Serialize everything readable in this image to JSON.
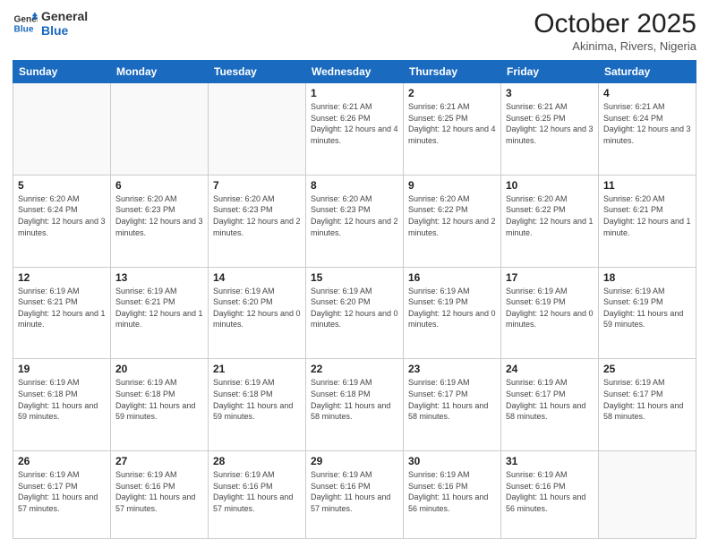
{
  "logo": {
    "line1": "General",
    "line2": "Blue"
  },
  "title": "October 2025",
  "location": "Akinima, Rivers, Nigeria",
  "weekdays": [
    "Sunday",
    "Monday",
    "Tuesday",
    "Wednesday",
    "Thursday",
    "Friday",
    "Saturday"
  ],
  "weeks": [
    [
      {
        "day": "",
        "info": ""
      },
      {
        "day": "",
        "info": ""
      },
      {
        "day": "",
        "info": ""
      },
      {
        "day": "1",
        "info": "Sunrise: 6:21 AM\nSunset: 6:26 PM\nDaylight: 12 hours and 4 minutes."
      },
      {
        "day": "2",
        "info": "Sunrise: 6:21 AM\nSunset: 6:25 PM\nDaylight: 12 hours and 4 minutes."
      },
      {
        "day": "3",
        "info": "Sunrise: 6:21 AM\nSunset: 6:25 PM\nDaylight: 12 hours and 3 minutes."
      },
      {
        "day": "4",
        "info": "Sunrise: 6:21 AM\nSunset: 6:24 PM\nDaylight: 12 hours and 3 minutes."
      }
    ],
    [
      {
        "day": "5",
        "info": "Sunrise: 6:20 AM\nSunset: 6:24 PM\nDaylight: 12 hours and 3 minutes."
      },
      {
        "day": "6",
        "info": "Sunrise: 6:20 AM\nSunset: 6:23 PM\nDaylight: 12 hours and 3 minutes."
      },
      {
        "day": "7",
        "info": "Sunrise: 6:20 AM\nSunset: 6:23 PM\nDaylight: 12 hours and 2 minutes."
      },
      {
        "day": "8",
        "info": "Sunrise: 6:20 AM\nSunset: 6:23 PM\nDaylight: 12 hours and 2 minutes."
      },
      {
        "day": "9",
        "info": "Sunrise: 6:20 AM\nSunset: 6:22 PM\nDaylight: 12 hours and 2 minutes."
      },
      {
        "day": "10",
        "info": "Sunrise: 6:20 AM\nSunset: 6:22 PM\nDaylight: 12 hours and 1 minute."
      },
      {
        "day": "11",
        "info": "Sunrise: 6:20 AM\nSunset: 6:21 PM\nDaylight: 12 hours and 1 minute."
      }
    ],
    [
      {
        "day": "12",
        "info": "Sunrise: 6:19 AM\nSunset: 6:21 PM\nDaylight: 12 hours and 1 minute."
      },
      {
        "day": "13",
        "info": "Sunrise: 6:19 AM\nSunset: 6:21 PM\nDaylight: 12 hours and 1 minute."
      },
      {
        "day": "14",
        "info": "Sunrise: 6:19 AM\nSunset: 6:20 PM\nDaylight: 12 hours and 0 minutes."
      },
      {
        "day": "15",
        "info": "Sunrise: 6:19 AM\nSunset: 6:20 PM\nDaylight: 12 hours and 0 minutes."
      },
      {
        "day": "16",
        "info": "Sunrise: 6:19 AM\nSunset: 6:19 PM\nDaylight: 12 hours and 0 minutes."
      },
      {
        "day": "17",
        "info": "Sunrise: 6:19 AM\nSunset: 6:19 PM\nDaylight: 12 hours and 0 minutes."
      },
      {
        "day": "18",
        "info": "Sunrise: 6:19 AM\nSunset: 6:19 PM\nDaylight: 11 hours and 59 minutes."
      }
    ],
    [
      {
        "day": "19",
        "info": "Sunrise: 6:19 AM\nSunset: 6:18 PM\nDaylight: 11 hours and 59 minutes."
      },
      {
        "day": "20",
        "info": "Sunrise: 6:19 AM\nSunset: 6:18 PM\nDaylight: 11 hours and 59 minutes."
      },
      {
        "day": "21",
        "info": "Sunrise: 6:19 AM\nSunset: 6:18 PM\nDaylight: 11 hours and 59 minutes."
      },
      {
        "day": "22",
        "info": "Sunrise: 6:19 AM\nSunset: 6:18 PM\nDaylight: 11 hours and 58 minutes."
      },
      {
        "day": "23",
        "info": "Sunrise: 6:19 AM\nSunset: 6:17 PM\nDaylight: 11 hours and 58 minutes."
      },
      {
        "day": "24",
        "info": "Sunrise: 6:19 AM\nSunset: 6:17 PM\nDaylight: 11 hours and 58 minutes."
      },
      {
        "day": "25",
        "info": "Sunrise: 6:19 AM\nSunset: 6:17 PM\nDaylight: 11 hours and 58 minutes."
      }
    ],
    [
      {
        "day": "26",
        "info": "Sunrise: 6:19 AM\nSunset: 6:17 PM\nDaylight: 11 hours and 57 minutes."
      },
      {
        "day": "27",
        "info": "Sunrise: 6:19 AM\nSunset: 6:16 PM\nDaylight: 11 hours and 57 minutes."
      },
      {
        "day": "28",
        "info": "Sunrise: 6:19 AM\nSunset: 6:16 PM\nDaylight: 11 hours and 57 minutes."
      },
      {
        "day": "29",
        "info": "Sunrise: 6:19 AM\nSunset: 6:16 PM\nDaylight: 11 hours and 57 minutes."
      },
      {
        "day": "30",
        "info": "Sunrise: 6:19 AM\nSunset: 6:16 PM\nDaylight: 11 hours and 56 minutes."
      },
      {
        "day": "31",
        "info": "Sunrise: 6:19 AM\nSunset: 6:16 PM\nDaylight: 11 hours and 56 minutes."
      },
      {
        "day": "",
        "info": ""
      }
    ]
  ]
}
